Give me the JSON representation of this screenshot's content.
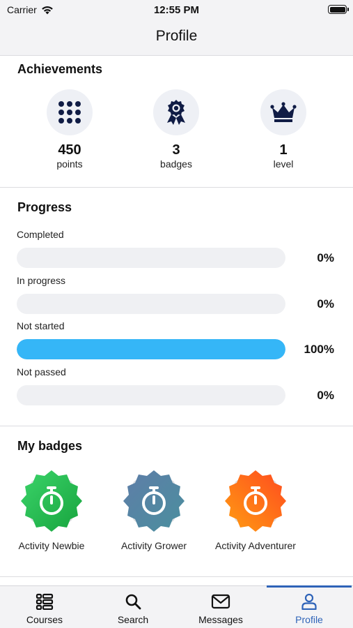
{
  "status_bar": {
    "carrier": "Carrier",
    "time": "12:55 PM"
  },
  "header": {
    "title": "Profile"
  },
  "achievements": {
    "title": "Achievements",
    "items": [
      {
        "icon": "grid-dots-icon",
        "value": "450",
        "label": "points"
      },
      {
        "icon": "award-ribbon-icon",
        "value": "3",
        "label": "badges"
      },
      {
        "icon": "crown-icon",
        "value": "1",
        "label": "level"
      }
    ]
  },
  "progress": {
    "title": "Progress",
    "bar_color": "#35b6f7",
    "items": [
      {
        "label": "Completed",
        "percent_text": "0%",
        "fraction": 0
      },
      {
        "label": "In progress",
        "percent_text": "0%",
        "fraction": 0
      },
      {
        "label": "Not started",
        "percent_text": "100%",
        "fraction": 1
      },
      {
        "label": "Not passed",
        "percent_text": "0%",
        "fraction": 0
      }
    ]
  },
  "badges": {
    "title": "My badges",
    "items": [
      {
        "label": "Activity Newbie",
        "icon": "stopwatch-icon",
        "colors": [
          "#3bd46a",
          "#17a33d"
        ]
      },
      {
        "label": "Activity Grower",
        "icon": "stopwatch-icon",
        "colors": [
          "#5f7da8",
          "#4a8f9e"
        ]
      },
      {
        "label": "Activity Adventurer",
        "icon": "stopwatch-icon",
        "colors": [
          "#ff4a1f",
          "#ff9d12"
        ]
      }
    ]
  },
  "tab_bar": {
    "active_color": "#2e63b8",
    "tabs": [
      {
        "label": "Courses",
        "icon": "courses-list-icon",
        "active": false
      },
      {
        "label": "Search",
        "icon": "search-icon",
        "active": false
      },
      {
        "label": "Messages",
        "icon": "envelope-icon",
        "active": false
      },
      {
        "label": "Profile",
        "icon": "user-icon",
        "active": true
      }
    ]
  }
}
